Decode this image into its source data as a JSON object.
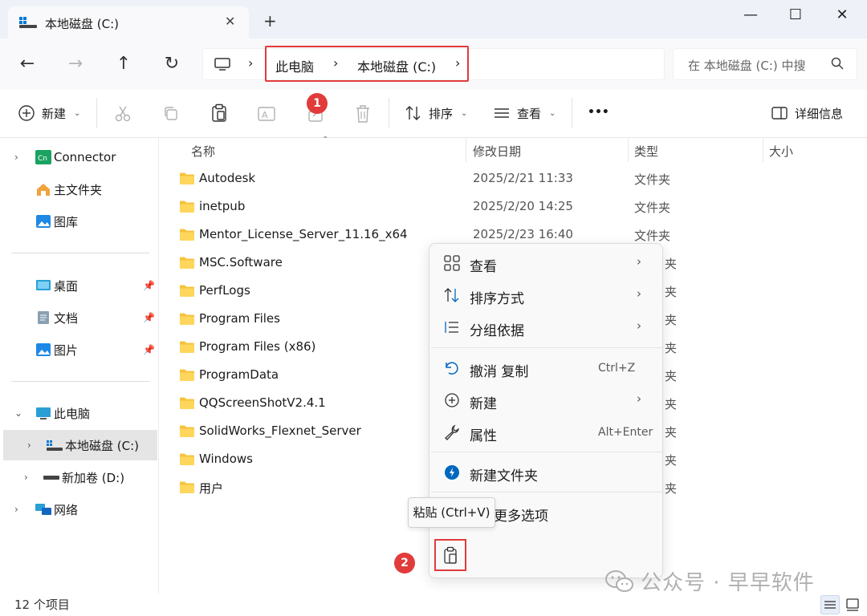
{
  "window": {
    "tab_title": "本地磁盘 (C:)",
    "tab_close": "✕",
    "new_tab": "+",
    "minimize": "—",
    "maximize": "☐",
    "close": "✕"
  },
  "address": {
    "crumbs": [
      "此电脑",
      "本地磁盘 (C:)"
    ],
    "search_placeholder": "在 本地磁盘 (C:) 中搜"
  },
  "toolbar": {
    "new_label": "新建",
    "sort_label": "排序",
    "view_label": "查看",
    "more_label": "•••",
    "details_label": "详细信息"
  },
  "badges": {
    "one": "1",
    "two": "2"
  },
  "sidebar": {
    "items": [
      {
        "label": "Connector"
      },
      {
        "label": "主文件夹"
      },
      {
        "label": "图库"
      },
      {
        "label": "桌面"
      },
      {
        "label": "文档"
      },
      {
        "label": "图片"
      },
      {
        "label": "此电脑"
      },
      {
        "label": "本地磁盘 (C:)"
      },
      {
        "label": "新加卷 (D:)"
      },
      {
        "label": "网络"
      }
    ]
  },
  "columns": {
    "name": "名称",
    "date": "修改日期",
    "type": "类型",
    "size": "大小"
  },
  "files": [
    {
      "name": "Autodesk",
      "date": "2025/2/21 11:33",
      "type": "文件夹"
    },
    {
      "name": "inetpub",
      "date": "2025/2/20 14:25",
      "type": "文件夹"
    },
    {
      "name": "Mentor_License_Server_11.16_x64",
      "date": "2025/2/23 16:40",
      "type": "文件夹"
    },
    {
      "name": "MSC.Software",
      "date": "",
      "type": "夹"
    },
    {
      "name": "PerfLogs",
      "date": "",
      "type": "夹"
    },
    {
      "name": "Program Files",
      "date": "",
      "type": "夹"
    },
    {
      "name": "Program Files (x86)",
      "date": "",
      "type": "夹"
    },
    {
      "name": "ProgramData",
      "date": "",
      "type": "夹"
    },
    {
      "name": "QQScreenShotV2.4.1",
      "date": "",
      "type": "夹"
    },
    {
      "name": "SolidWorks_Flexnet_Server",
      "date": "",
      "type": "夹"
    },
    {
      "name": "Windows",
      "date": "",
      "type": "夹"
    },
    {
      "name": "用户",
      "date": "",
      "type": "夹"
    }
  ],
  "context_menu": {
    "view": "查看",
    "sort_by": "排序方式",
    "group_by": "分组依据",
    "undo": "撤消 复制",
    "undo_shortcut": "Ctrl+Z",
    "new": "新建",
    "properties": "属性",
    "properties_shortcut": "Alt+Enter",
    "new_folder": "新建文件夹",
    "more_options": "更多选项",
    "arrow": "›"
  },
  "tooltip": {
    "paste": "粘贴 (Ctrl+V)"
  },
  "status": {
    "count": "12 个项目"
  },
  "watermark": {
    "text": "公众号 · 早早软件"
  },
  "colors": {
    "accent": "#0067c0",
    "highlight_red": "#e23b3b",
    "folder": "#f5c33b"
  }
}
